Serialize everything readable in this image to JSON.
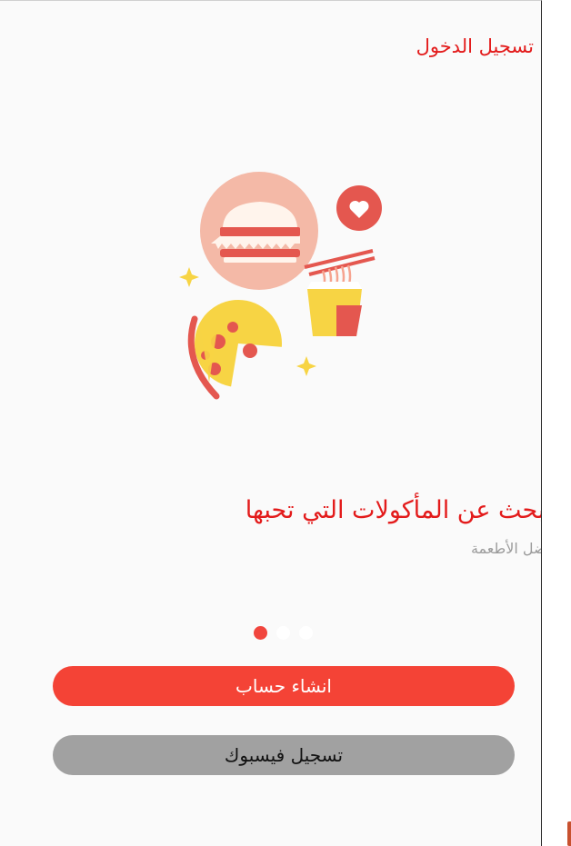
{
  "header": {
    "login_label": "تسجيل الدخول"
  },
  "onboarding": {
    "headline": "ابحث عن المأكولات التي تحبها",
    "subline": "افضل الأطعمة",
    "pages_total": 3,
    "current_page": 1
  },
  "buttons": {
    "create_account": "انشاء حساب",
    "facebook_login": "تسجيل فيسبوك"
  },
  "colors": {
    "accent": "#e31b1b",
    "primary_button": "#f44336",
    "secondary_button": "#a1a1a1",
    "dot_active": "#f1453d"
  },
  "illustration": {
    "icons": [
      "burger-icon",
      "heart-icon",
      "noodle-box-icon",
      "pizza-icon",
      "sparkle-icon"
    ]
  }
}
